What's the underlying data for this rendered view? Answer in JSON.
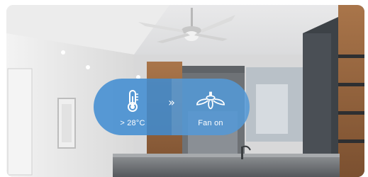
{
  "automation": {
    "condition": {
      "icon": "thermometer-icon",
      "label": "> 28°C"
    },
    "separator_icon": "double-chevron-right-icon",
    "separator_glyph": "»",
    "action": {
      "icon": "ceiling-fan-icon",
      "label": "Fan on"
    }
  },
  "colors": {
    "pill": "#3f8cd2",
    "text": "#ffffff"
  },
  "background": {
    "scene": "kitchen-interior-photo"
  }
}
